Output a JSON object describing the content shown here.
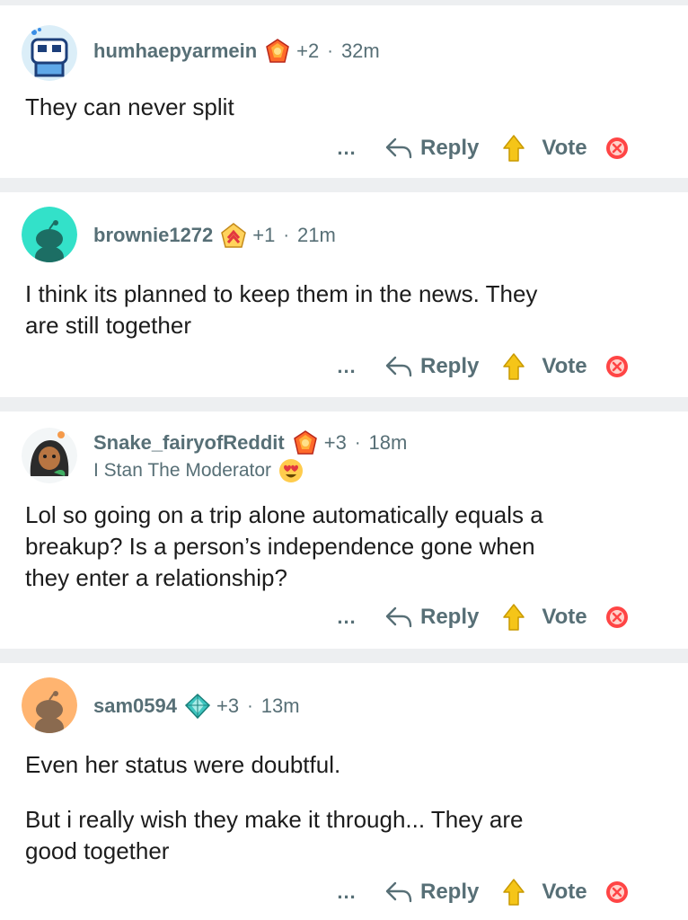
{
  "comments": [
    {
      "username": "humhaepyarmein",
      "karma": "+2",
      "time": "32m",
      "flair": "",
      "text_lines": [
        "They can never split"
      ],
      "avatar_color": "#a6d5ef"
    },
    {
      "username": "brownie1272",
      "karma": "+1",
      "time": "21m",
      "flair": "",
      "text_lines": [
        "I think its planned to keep them in the news. They",
        "are still together"
      ],
      "avatar_color": "#33e1c9"
    },
    {
      "username": "Snake_fairyofReddit",
      "karma": "+3",
      "time": "18m",
      "flair": "I Stan The Moderator",
      "text_lines": [
        "Lol so going on a trip alone automatically equals a",
        "breakup? Is a person’s independence gone when",
        "they enter a relationship?"
      ],
      "avatar_color": "#ffffff"
    },
    {
      "username": "sam0594",
      "karma": "+3",
      "time": "13m",
      "flair": "",
      "text_lines": [
        "Even her status were doubtful.",
        "",
        "But i really wish they make it through... They are",
        "good together"
      ],
      "avatar_color": "#ffb470"
    }
  ],
  "actions": {
    "more": "...",
    "reply": "Reply",
    "vote": "Vote"
  },
  "separator_dot": "·",
  "icons": {
    "reply": "reply-arrow-icon",
    "upvote": "upvote-arrow-icon",
    "downvote": "downvote-arrow-icon",
    "award_fire": "fire-gem-award-icon",
    "award_medal": "chevron-medal-award-icon",
    "award_diamond": "diamond-award-icon",
    "flair_emoji": "heart-eyes-emoji-icon"
  },
  "colors": {
    "separator": "#edeff1",
    "username": "#576f76",
    "upvote_yellow": "#f5c518",
    "downvote_red": "#ff4545"
  }
}
